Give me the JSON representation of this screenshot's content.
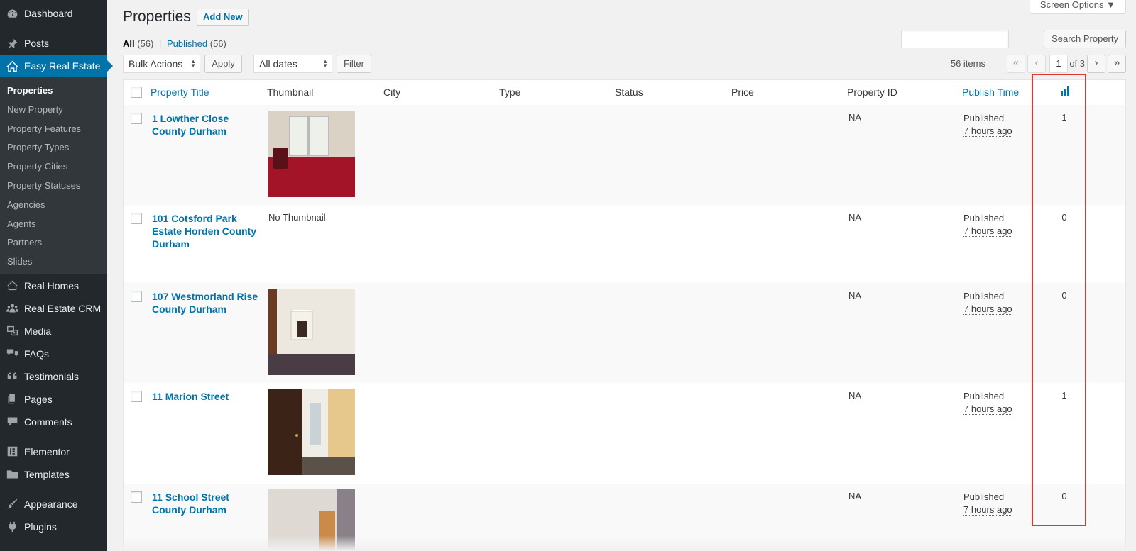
{
  "sidebar": {
    "top_items": [
      {
        "label": "Dashboard",
        "icon": "dashboard-icon"
      },
      {
        "label": "Posts",
        "icon": "pushpin-icon"
      },
      {
        "label": "Easy Real Estate",
        "icon": "house-icon"
      }
    ],
    "submenu": [
      "Properties",
      "New Property",
      "Property Features",
      "Property Types",
      "Property Cities",
      "Property Statuses",
      "Agencies",
      "Agents",
      "Partners",
      "Slides"
    ],
    "bottom_items": [
      {
        "label": "Real Homes",
        "icon": "house-outline-icon"
      },
      {
        "label": "Real Estate CRM",
        "icon": "users-group-icon"
      },
      {
        "label": "Media",
        "icon": "media-icon"
      },
      {
        "label": "FAQs",
        "icon": "chat-bubbles-icon"
      },
      {
        "label": "Testimonials",
        "icon": "quote-icon"
      },
      {
        "label": "Pages",
        "icon": "pages-icon"
      },
      {
        "label": "Comments",
        "icon": "comment-icon"
      },
      {
        "label": "Elementor",
        "icon": "elementor-icon"
      },
      {
        "label": "Templates",
        "icon": "folder-icon"
      },
      {
        "label": "Appearance",
        "icon": "paintbrush-icon"
      },
      {
        "label": "Plugins",
        "icon": "plug-icon"
      }
    ]
  },
  "header": {
    "screen_options": "Screen Options ▼",
    "title": "Properties",
    "add_new": "Add New"
  },
  "filters": {
    "all": "All",
    "all_count": "(56)",
    "sep": "|",
    "published": "Published",
    "published_count": "(56)"
  },
  "search": {
    "value": "",
    "button": "Search Property"
  },
  "tablenav": {
    "bulk_actions": "Bulk Actions",
    "apply": "Apply",
    "dates": "All dates",
    "filter": "Filter",
    "items": "56 items",
    "first": "«",
    "prev": "‹",
    "current_page": "1",
    "of_pages": "of 3",
    "next": "›",
    "last": "»"
  },
  "columns": {
    "title": "Property Title",
    "thumbnail": "Thumbnail",
    "city": "City",
    "type": "Type",
    "status": "Status",
    "price": "Price",
    "property_id": "Property ID",
    "publish_time": "Publish Time",
    "views_icon": "bar-chart-icon"
  },
  "rows": [
    {
      "title": "1 Lowther Close County Durham",
      "thumbnail": "photo",
      "property_id": "NA",
      "status": "Published",
      "time": "7 hours ago",
      "views": "1"
    },
    {
      "title": "101 Cotsford Park Estate Horden County Durham",
      "thumbnail": "No Thumbnail",
      "property_id": "NA",
      "status": "Published",
      "time": "7 hours ago",
      "views": "0"
    },
    {
      "title": "107 Westmorland Rise County Durham",
      "thumbnail": "photo",
      "property_id": "NA",
      "status": "Published",
      "time": "7 hours ago",
      "views": "0"
    },
    {
      "title": "11 Marion Street",
      "thumbnail": "photo",
      "property_id": "NA",
      "status": "Published",
      "time": "7 hours ago",
      "views": "1"
    },
    {
      "title": "11 School Street County Durham",
      "thumbnail": "photo",
      "property_id": "NA",
      "status": "Published",
      "time": "7 hours ago",
      "views": "0"
    }
  ],
  "colors": {
    "sidebar_bg": "#23282d",
    "accent": "#0073aa",
    "highlight": "#e3342f"
  }
}
